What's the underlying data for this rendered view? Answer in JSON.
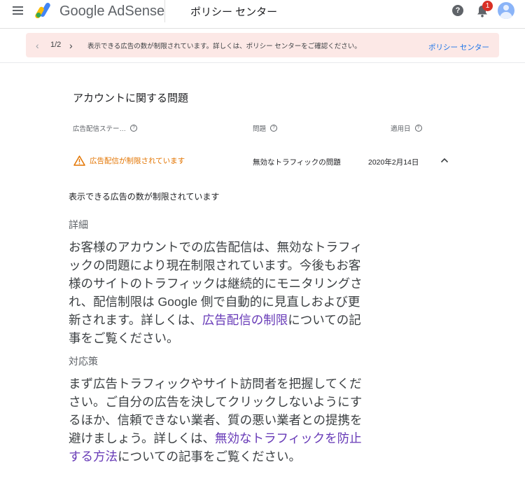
{
  "header": {
    "brand": "Google AdSense",
    "page_title": "ポリシー センター",
    "notification_count": "1",
    "help_glyph": "?"
  },
  "banner": {
    "prev_glyph": "‹",
    "next_glyph": "›",
    "pager": "1/2",
    "message": "表示できる広告の数が制限されています。詳しくは、ポリシー センターをご確認ください。",
    "link": "ポリシー センター"
  },
  "issues": {
    "title": "アカウントに関する問題",
    "columns": [
      "広告配信ステー…",
      "問題",
      "適用日"
    ],
    "row": {
      "status": "広告配信が制限されています",
      "issue": "無効なトラフィックの問題",
      "date": "2020年2月14日"
    }
  },
  "detail": {
    "headline": "表示できる広告の数が制限されています",
    "details_title": "詳細",
    "details_text_1": "お客様のアカウントでの広告配信は、無効なトラフィックの問題により現在制限されています。今後もお客様のサイトのトラフィックは継続的にモニタリングされ、配信制限は Google 側で自動的に見直しおよび更新されます。詳しくは、",
    "details_link": "広告配信の制限",
    "details_text_2": "についての記事をご覧ください。",
    "action_title": "対応策",
    "action_text_1": "まず広告トラフィックやサイト訪問者を把握してください。ご自分の広告を決してクリックしないようにするほか、信頼できない業者、質の悪い業者との提携を避けましょう。詳しくは、",
    "action_link": "無効なトラフィックを防止する方法",
    "action_text_2": "についての記事をご覧ください。"
  },
  "colors": {
    "warning": "#e37400",
    "link": "#673ab7",
    "banner_bg": "#fce8e6",
    "banner_link": "#1a73e8"
  },
  "icons": [
    "menu-icon",
    "adsense-logo",
    "help-icon",
    "bell-icon",
    "avatar",
    "chevron-left-icon",
    "chevron-right-icon",
    "help-circle-icon",
    "warning-icon",
    "chevron-up-icon"
  ]
}
